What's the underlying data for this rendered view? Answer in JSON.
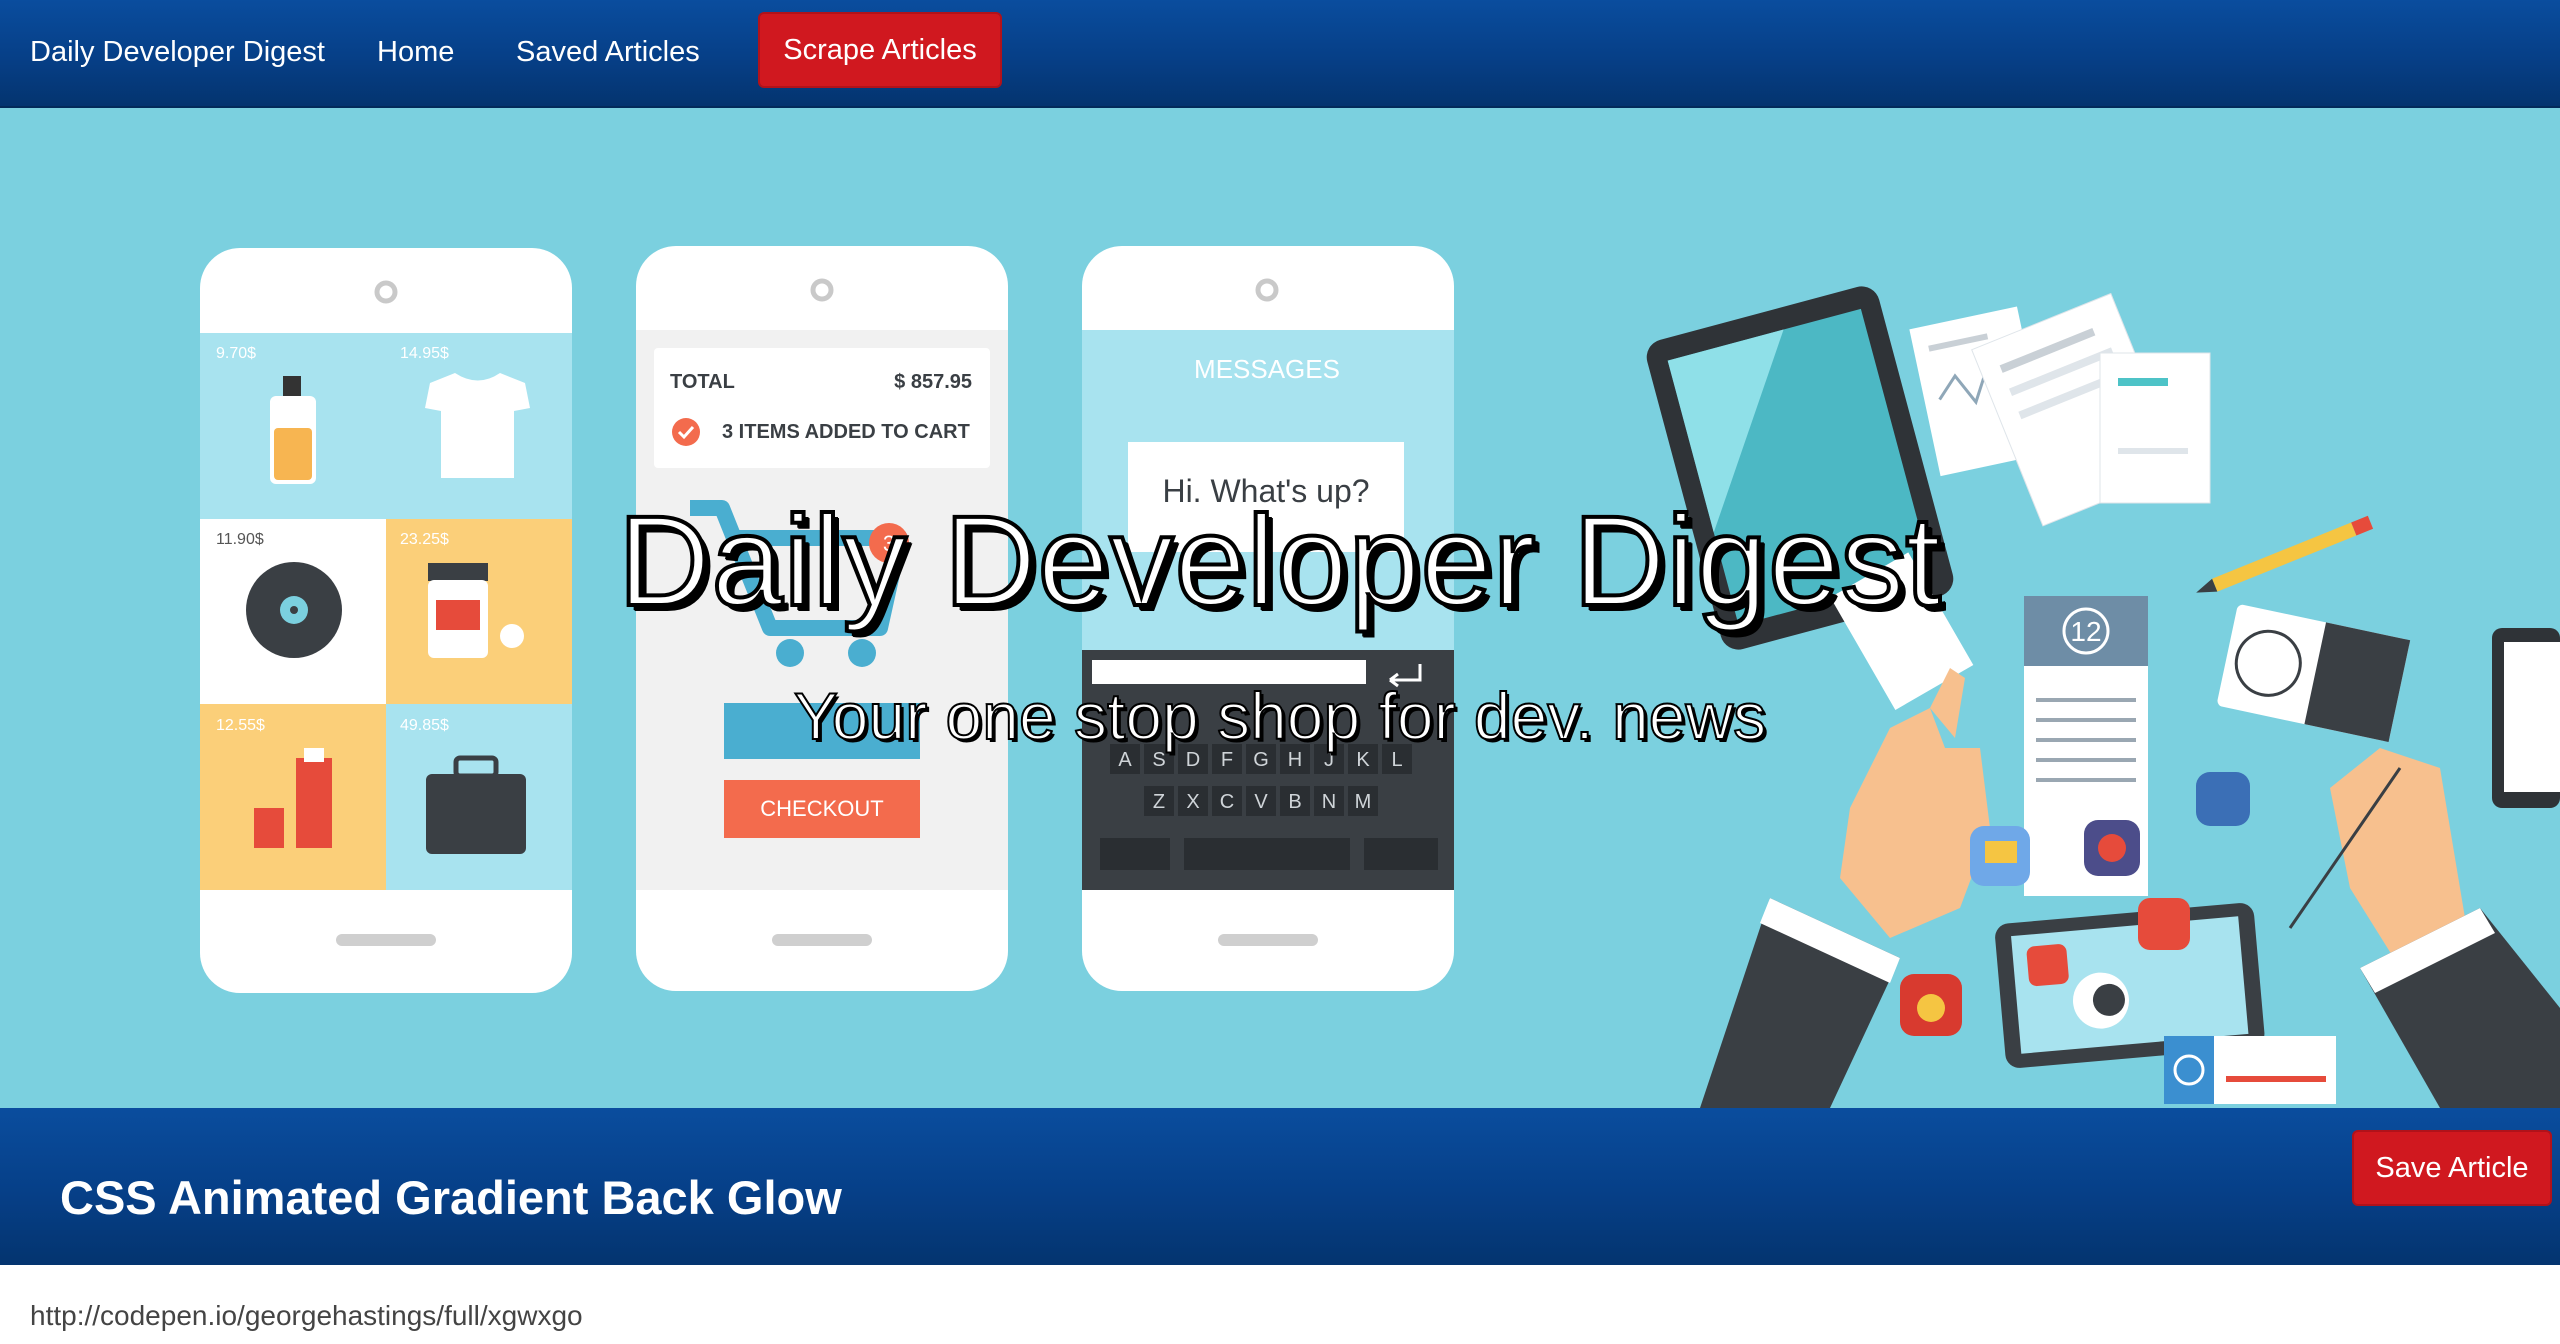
{
  "navbar": {
    "brand": "Daily Developer Digest",
    "home": "Home",
    "saved_articles": "Saved Articles",
    "scrape_button": "Scrape Articles"
  },
  "hero": {
    "title": "Daily Developer Digest",
    "subtitle": "Your one stop shop for dev. news",
    "illustration": {
      "phone1_prices": [
        "9.70$",
        "14.95$",
        "11.90$",
        "23.25$",
        "12.55$",
        "49.85$"
      ],
      "phone2_total_label": "TOTAL",
      "phone2_total_value": "$ 857.95",
      "phone2_cart_text": "3 ITEMS ADDED TO CART",
      "phone2_badge": "3",
      "phone2_checkout": "CHECKOUT",
      "phone3_header": "MESSAGES",
      "phone3_bubble": "Hi. What's up?",
      "keyboard_row2": [
        "A",
        "S",
        "D",
        "F",
        "G",
        "H",
        "J",
        "K",
        "L"
      ],
      "keyboard_row3": [
        "Z",
        "X",
        "C",
        "V",
        "B",
        "N",
        "M"
      ],
      "calendar_day": "12"
    }
  },
  "article": {
    "title": "CSS Animated Gradient Back Glow",
    "save_button": "Save Article",
    "url": "http://codepen.io/georgehastings/full/xgwxgo"
  },
  "colors": {
    "navbar": "#063f87",
    "hero_bg": "#7bd0df",
    "button_red": "#d0181f"
  }
}
